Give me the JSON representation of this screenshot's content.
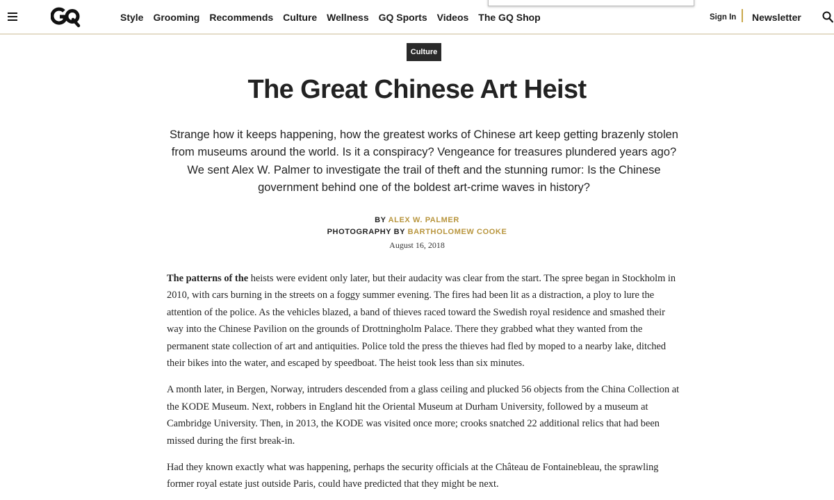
{
  "header": {
    "logo_text": "GQ",
    "nav": [
      "Style",
      "Grooming",
      "Recommends",
      "Culture",
      "Wellness",
      "GQ Sports",
      "Videos",
      "The GQ Shop"
    ],
    "sign_in": "Sign In",
    "newsletter": "Newsletter",
    "icons": {
      "menu": "hamburger-icon",
      "search": "search-icon"
    },
    "accent_color": "#c9a74a"
  },
  "article": {
    "category": "Culture",
    "title": "The Great Chinese Art Heist",
    "dek": "Strange how it keeps happening, how the greatest works of Chinese art keep getting brazenly stolen from museums around the world. Is it a conspiracy? Vengeance for treasures plundered years ago? We sent Alex W. Palmer to investigate the trail of theft and the stunning rumor: Is the Chinese government behind one of the boldest art-crime waves in history?",
    "byline": {
      "by_label": "BY",
      "author": "ALEX W. PALMER",
      "photo_label": "PHOTOGRAPHY BY",
      "photographer": "BARTHOLOMEW COOKE",
      "date": "August 16, 2018"
    },
    "paragraphs": [
      {
        "lead": "The patterns of the",
        "text": " heists were evident only later, but their audacity was clear from the start. The spree began in Stockholm in 2010, with cars burning in the streets on a foggy summer evening. The fires had been lit as a distraction, a ploy to lure the attention of the police. As the vehicles blazed, a band of thieves raced toward the Swedish royal residence and smashed their way into the Chinese Pavilion on the grounds of Drottningholm Palace. There they grabbed what they wanted from the permanent state collection of art and antiquities. Police told the press the thieves had fled by moped to a nearby lake, ditched their bikes into the water, and escaped by speedboat. The heist took less than six minutes."
      },
      {
        "text": "A month later, in Bergen, Norway, intruders descended from a glass ceiling and plucked 56 objects from the China Collection at the KODE Museum. Next, robbers in England hit the Oriental Museum at Durham University, followed by a museum at Cambridge University. Then, in 2013, the KODE was visited once more; crooks snatched 22 additional relics that had been missed during the first break-in."
      },
      {
        "text": "Had they known exactly what was happening, perhaps the security officials at the Château de Fontainebleau, the sprawling former royal estate just outside Paris, could have predicted that they might be next."
      }
    ]
  }
}
